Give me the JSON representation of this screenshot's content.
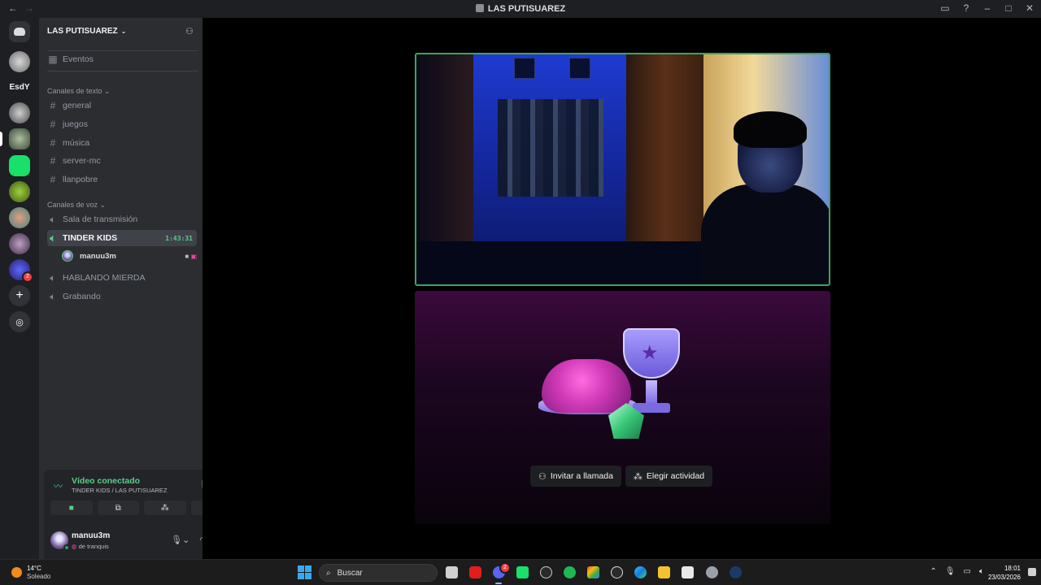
{
  "window": {
    "title": "LAS PUTISUAREZ"
  },
  "guilds": {
    "label": "EsdY",
    "badge": "2"
  },
  "server": {
    "name": "LAS PUTISUAREZ",
    "events": "Eventos",
    "text_category": "Canales de texto",
    "text_channels": [
      "general",
      "juegos",
      "música",
      "server-mc",
      "llanpobre"
    ],
    "voice_category": "Canales de voz",
    "voice_channels": [
      {
        "name": "Sala de transmisión"
      },
      {
        "name": "TINDER KIDS",
        "timer": "1:43:31",
        "active": true
      },
      {
        "name": "HABLANDO MIERDA"
      },
      {
        "name": "Grabando"
      }
    ],
    "voice_user": "manuu3m"
  },
  "voice_panel": {
    "status": "Vídeo conectado",
    "location": "TINDER KIDS / LAS PUTISUAREZ"
  },
  "user_panel": {
    "username": "manuu3m",
    "status": "de tranquis"
  },
  "activity": {
    "invite_label": "Invitar a llamada",
    "choose_label": "Elegir actividad"
  },
  "taskbar": {
    "temperature": "14°C",
    "weather": "Soleado",
    "search_placeholder": "Buscar",
    "discord_badge": "2",
    "time": "18:01",
    "date": "23/03/2026"
  },
  "colors": {
    "accent_green": "#3ba55c",
    "discord_bg": "#2b2d31",
    "mention": "#eb459e"
  }
}
